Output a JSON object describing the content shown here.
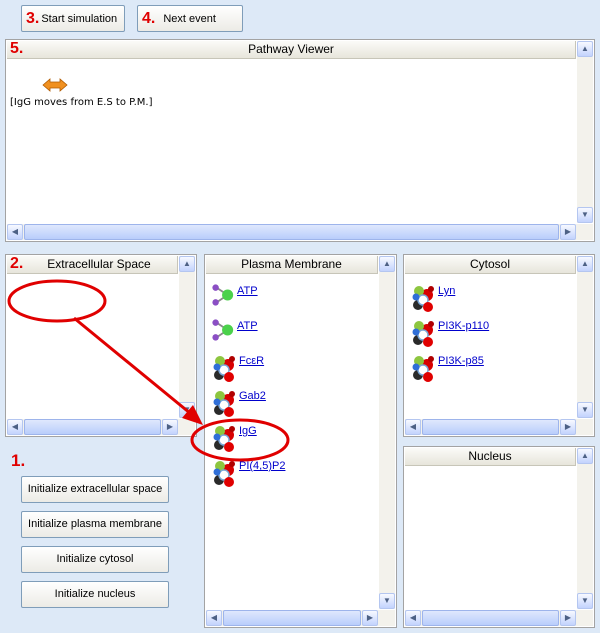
{
  "top_buttons": {
    "start": {
      "number": "3.",
      "label": "Start simulation"
    },
    "next": {
      "number": "4.",
      "label": "Next event"
    }
  },
  "pathway_viewer": {
    "number": "5.",
    "title": "Pathway Viewer",
    "event_text": "[IgG moves from E.S to P.M.]"
  },
  "extracellular": {
    "number": "2.",
    "title": "Extracellular Space"
  },
  "plasma_membrane": {
    "title": "Plasma Membrane",
    "items": [
      {
        "label": "ATP",
        "icon": "atp-molecule-icon"
      },
      {
        "label": "ATP",
        "icon": "atp-molecule-icon"
      },
      {
        "label": "FcεR",
        "icon": "protein-molecule-icon"
      },
      {
        "label": "Gab2",
        "icon": "protein-molecule-icon"
      },
      {
        "label": "IgG",
        "icon": "protein-molecule-icon"
      },
      {
        "label": "PI(4,5)P2",
        "icon": "protein-molecule-icon"
      }
    ]
  },
  "cytosol": {
    "title": "Cytosol",
    "items": [
      {
        "label": "Lyn",
        "icon": "protein-molecule-icon"
      },
      {
        "label": "PI3K-p110",
        "icon": "protein-molecule-icon"
      },
      {
        "label": "PI3K-p85",
        "icon": "protein-molecule-icon"
      }
    ]
  },
  "nucleus": {
    "title": "Nucleus"
  },
  "init": {
    "number": "1.",
    "buttons": [
      "Initialize extracellular space",
      "Initialize plasma membrane",
      "Initialize cytosol",
      "Initialize nucleus"
    ]
  },
  "colors": {
    "annotation_red": "#e00000",
    "link_blue": "#0000cc",
    "background": "#dde9f7"
  }
}
